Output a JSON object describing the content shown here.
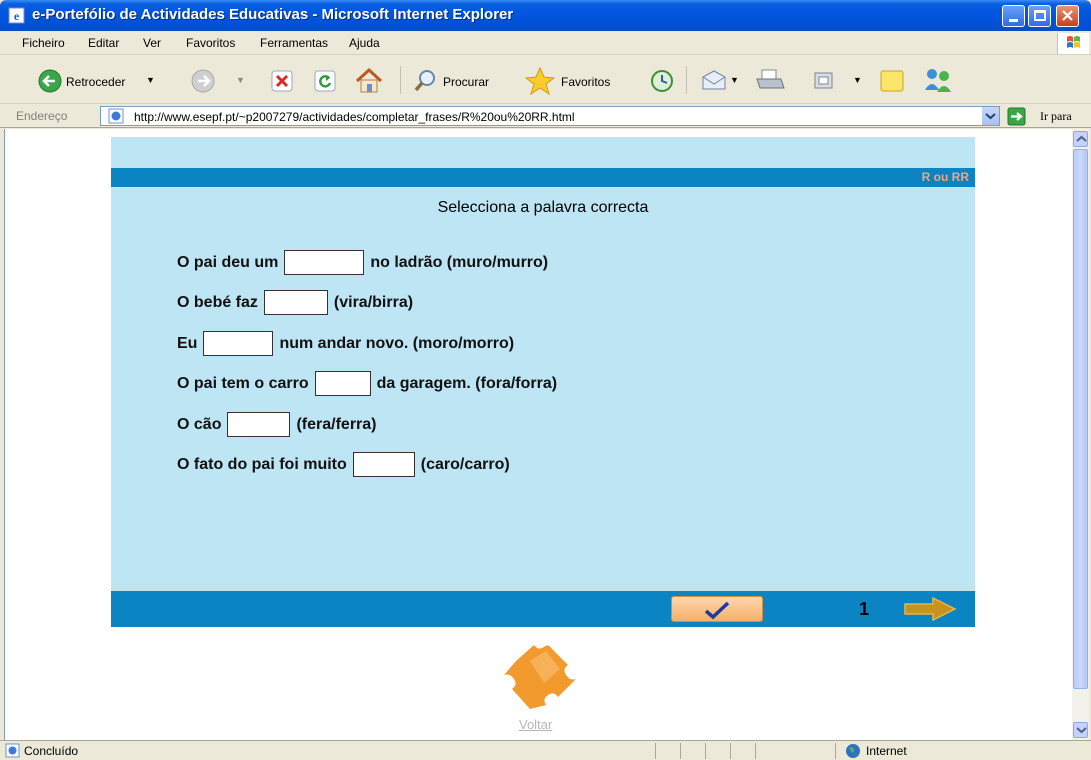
{
  "window": {
    "title": "e-Portefólio de Actividades Educativas - Microsoft Internet Explorer"
  },
  "menu": [
    "Ficheiro",
    "Editar",
    "Ver",
    "Favoritos",
    "Ferramentas",
    "Ajuda"
  ],
  "toolbar": {
    "back_label": "Retroceder",
    "search_label": "Procurar",
    "favorites_label": "Favoritos"
  },
  "address": {
    "label": "Endereço",
    "url": "http://www.esepf.pt/~p2007279/actividades/completar_frases/R%20ou%20RR.html",
    "go_label": "Ir para"
  },
  "activity": {
    "tag": "R ou RR",
    "instruction": "Selecciona a palavra correcta",
    "sentences": [
      {
        "before": "O pai deu um",
        "after": "no ladrão (muro/murro)",
        "answer": ""
      },
      {
        "before": "O bebé faz",
        "after": "(vira/birra)",
        "answer": ""
      },
      {
        "before": "Eu",
        "after": "num andar novo. (moro/morro)",
        "answer": ""
      },
      {
        "before": "O pai tem o carro",
        "after": "da garagem. (fora/forra)",
        "answer": ""
      },
      {
        "before": "O cão",
        "after": "(fera/ferra)",
        "answer": ""
      },
      {
        "before": "O fato do pai foi muito",
        "after": "(caro/carro)",
        "answer": ""
      }
    ],
    "check_icon": "checkmark-icon",
    "page_number": "1",
    "next_icon": "arrow-right-icon"
  },
  "footer": {
    "back_link": "Voltar"
  },
  "status": {
    "text": "Concluído",
    "zone": "Internet"
  },
  "colors": {
    "panel": "#BEE5F3",
    "stripe": "#0A84C2",
    "tag": "#F2A57A",
    "accent_orange": "#F39A2E"
  }
}
